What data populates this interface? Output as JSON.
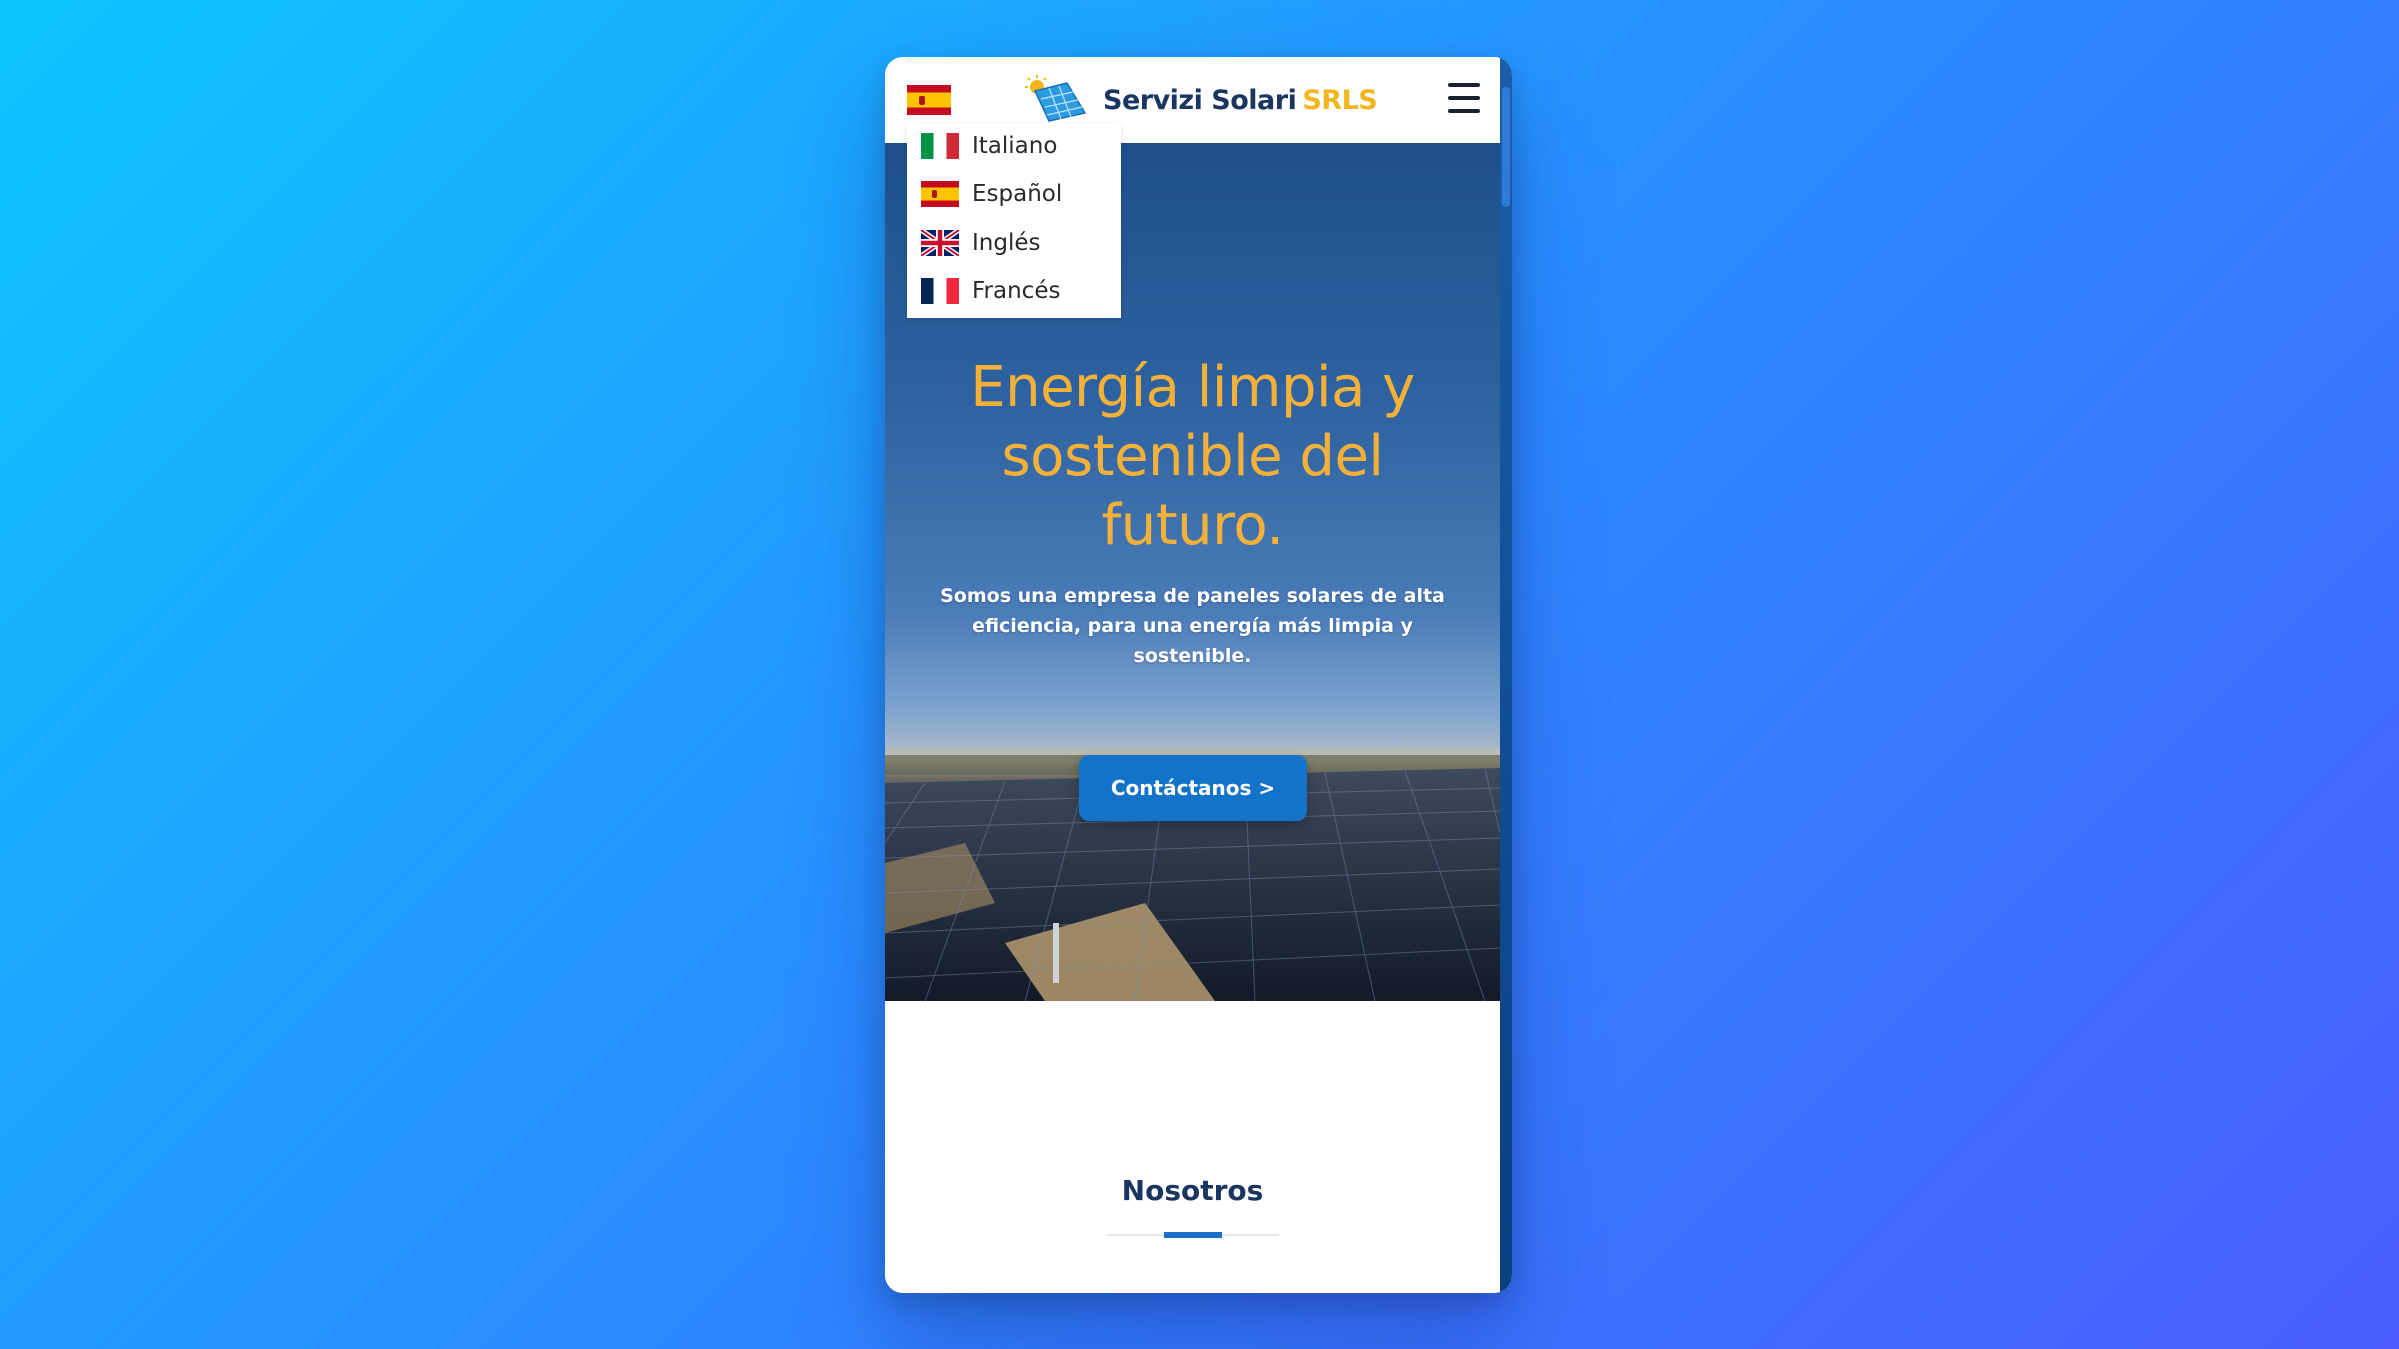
{
  "brand": {
    "name": "Servizi Solari",
    "suffix": "SRLS",
    "name_color": "#1a3560",
    "suffix_color": "#f2b61e",
    "logo_icon": "solar-panel-sun-icon"
  },
  "header": {
    "current_language_flag": "flag-es-icon",
    "menu_icon": "hamburger-menu-icon"
  },
  "language_menu": {
    "items": [
      {
        "label": "Italiano",
        "flag": "flag-it-icon"
      },
      {
        "label": "Español",
        "flag": "flag-es-icon"
      },
      {
        "label": "Inglés",
        "flag": "flag-uk-icon"
      },
      {
        "label": "Francés",
        "flag": "flag-fr-icon"
      }
    ]
  },
  "hero": {
    "title_line1": "Energía limpia y",
    "title_line2": "sostenible del",
    "title_line3": "futuro.",
    "subtitle": "Somos una empresa de paneles solares de alta eficiencia, para una energía más limpia y sostenible.",
    "cta_label": "Contáctanos >",
    "title_color": "#f4b13a",
    "cta_color": "#1273c9"
  },
  "about": {
    "title": "Nosotros",
    "accent_color": "#1b6fc8"
  }
}
